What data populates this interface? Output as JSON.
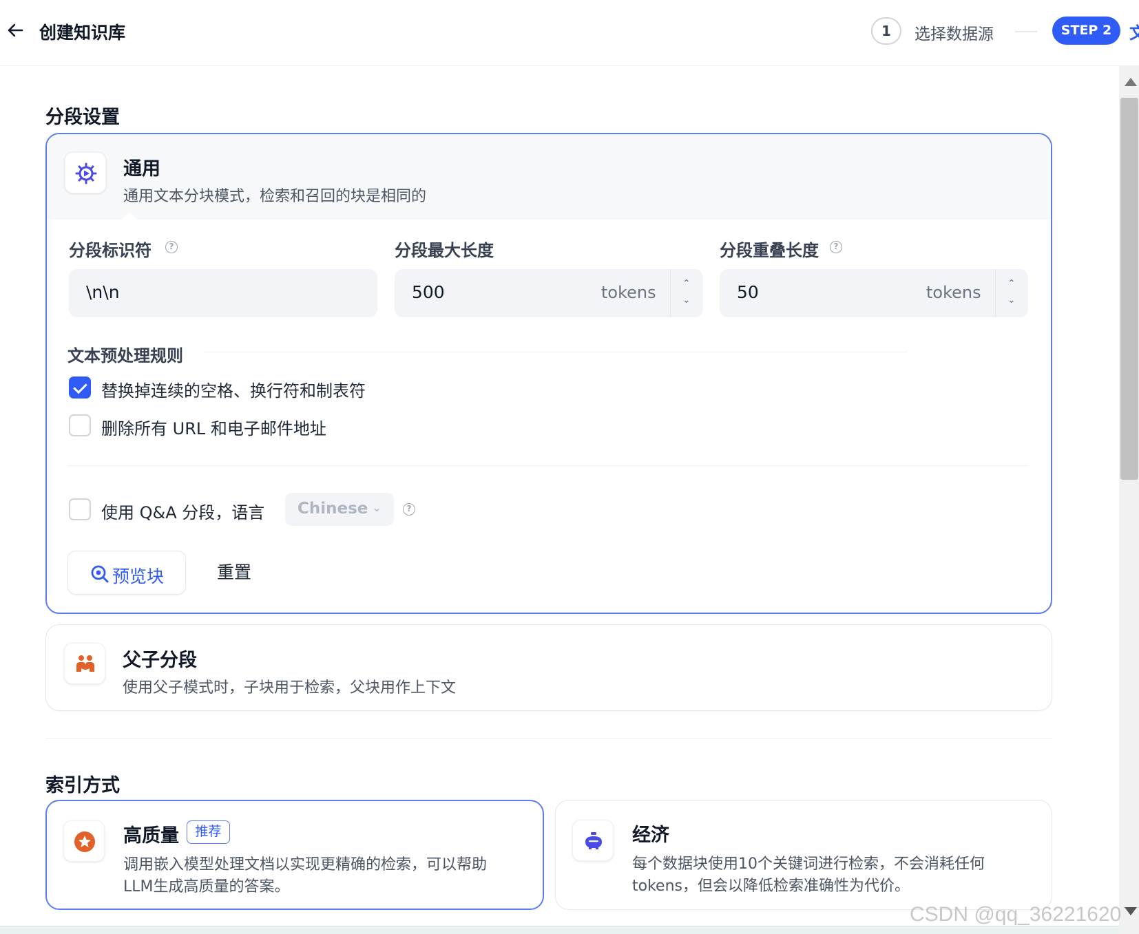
{
  "header": {
    "title": "创建知识库",
    "steps": [
      {
        "number": "1",
        "label": "选择数据源"
      },
      {
        "label": "STEP 2",
        "overflow_text": "文"
      }
    ]
  },
  "segment_section": {
    "title": "分段设置",
    "general": {
      "title": "通用",
      "description": "通用文本分块模式，检索和召回的块是相同的",
      "fields": {
        "identifier": {
          "label": "分段标识符",
          "value": "\\n\\n"
        },
        "max_length": {
          "label": "分段最大长度",
          "value": "500",
          "unit": "tokens"
        },
        "overlap": {
          "label": "分段重叠长度",
          "value": "50",
          "unit": "tokens"
        }
      },
      "preprocess": {
        "title": "文本预处理规则",
        "rules": [
          {
            "label": "替换掉连续的空格、换行符和制表符",
            "checked": true
          },
          {
            "label": "删除所有 URL 和电子邮件地址",
            "checked": false
          }
        ]
      },
      "qa": {
        "label": "使用 Q&A 分段，语言",
        "checked": false,
        "language": "Chinese"
      },
      "buttons": {
        "preview": "预览块",
        "reset": "重置"
      }
    },
    "parent_child": {
      "title": "父子分段",
      "description": "使用父子模式时，子块用于检索，父块用作上下文"
    }
  },
  "index_section": {
    "title": "索引方式",
    "high_quality": {
      "title": "高质量",
      "badge": "推荐",
      "description_line1": "调用嵌入模型处理文档以实现更精确的检索，可以帮助",
      "description_line2": "LLM生成高质量的答案。"
    },
    "economy": {
      "title": "经济",
      "description_line1": "每个数据块使用10个关键词进行检索，不会消耗任何",
      "description_line2": "tokens，但会以降低检索准确性为代价。"
    }
  },
  "watermark": "CSDN @qq_36221620",
  "colors": {
    "accent": "#2f5cf6",
    "border_selected": "#5b7cf5",
    "orange_icon": "#e0622a"
  }
}
